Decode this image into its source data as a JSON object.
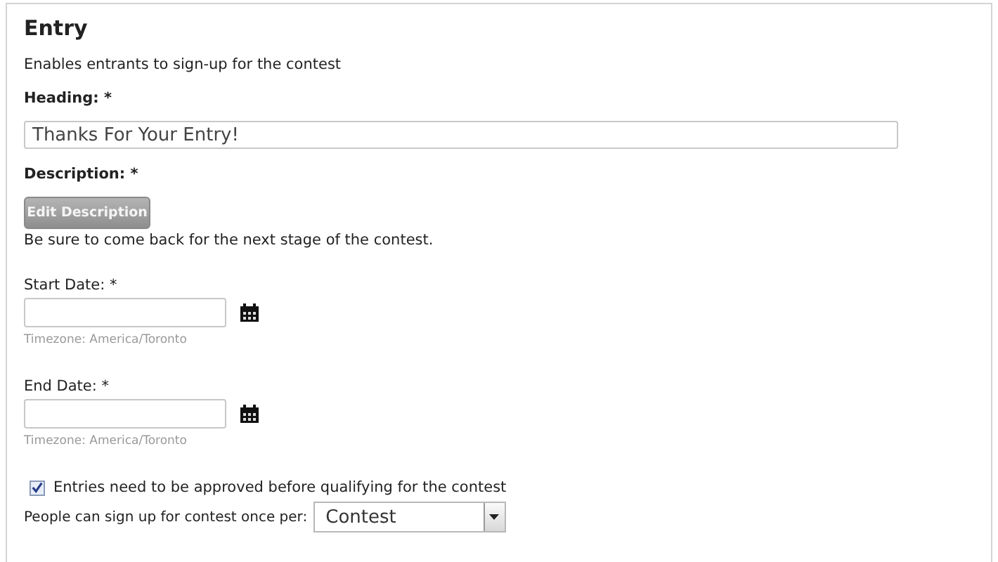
{
  "section": {
    "title": "Entry",
    "subtitle": "Enables entrants to sign-up for the contest"
  },
  "heading": {
    "label": "Heading: *",
    "value": "Thanks For Your Entry!"
  },
  "description": {
    "label": "Description: *",
    "button": "Edit Description",
    "text": "Be sure to come back for the next stage of the contest."
  },
  "dates": [
    {
      "label": "Start Date: *",
      "timezone": "Timezone: America/Toronto"
    },
    {
      "label": "End Date: *",
      "timezone": "Timezone: America/Toronto"
    }
  ],
  "approval": {
    "label": "Entries need to be approved before qualifying for the contest",
    "checked": true
  },
  "signup": {
    "label": "People can sign up for contest once per:",
    "value": "Contest"
  }
}
